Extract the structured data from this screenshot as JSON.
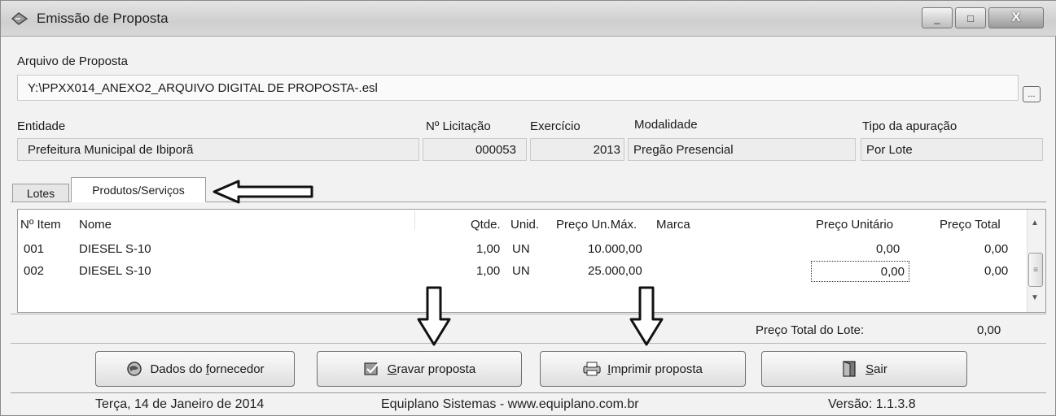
{
  "window": {
    "title": "Emissão de Proposta",
    "close_glyph": "X",
    "min_glyph": "_",
    "max_glyph": "□"
  },
  "arquivo": {
    "label": "Arquivo de Proposta",
    "value": "Y:\\PPXX014_ANEXO2_ARQUIVO DIGITAL DE PROPOSTA-.esl",
    "browse_label": "..."
  },
  "info": {
    "entidade_label": "Entidade",
    "entidade_value": "Prefeitura Municipal de Ibiporã",
    "licitacao_label": "Nº Licitação",
    "licitacao_value": "000053",
    "exercicio_label": "Exercício",
    "exercicio_value": "2013",
    "modalidade_label": "Modalidade",
    "modalidade_value": "Pregão Presencial",
    "apuracao_label": "Tipo da apuração",
    "apuracao_value": "Por Lote"
  },
  "tabs": [
    {
      "label": "Lotes",
      "active": false
    },
    {
      "label": "Produtos/Serviços",
      "active": true
    }
  ],
  "grid": {
    "columns": [
      "Nº Item",
      "Nome",
      "Qtde.",
      "Unid.",
      "Preço Un.Máx.",
      "Marca",
      "Preço Unitário",
      "Preço Total"
    ],
    "rows": [
      {
        "item": "001",
        "nome": "DIESEL S-10",
        "qtde": "1,00",
        "unid": "UN",
        "preco_max": "10.000,00",
        "marca": "",
        "preco_unit": "0,00",
        "preco_total": "0,00"
      },
      {
        "item": "002",
        "nome": "DIESEL S-10",
        "qtde": "1,00",
        "unid": "UN",
        "preco_max": "25.000,00",
        "marca": "",
        "preco_unit": "0,00",
        "preco_total": "0,00"
      }
    ],
    "scroll_up": "▲",
    "scroll_down": "▼",
    "scroll_grip": "≡"
  },
  "total": {
    "label": "Preço Total do Lote:",
    "value": "0,00"
  },
  "buttons": {
    "dados_pre": "Dados do ",
    "dados_key": "f",
    "dados_post": "ornecedor",
    "gravar_key": "G",
    "gravar_post": "ravar proposta",
    "imprimir_key": "I",
    "imprimir_post": "mprimir proposta",
    "sair_key": "S",
    "sair_post": "air"
  },
  "status": {
    "date": "Terça, 14 de Janeiro de 2014",
    "company": "Equiplano Sistemas - www.equiplano.com.br",
    "version": "Versão: 1.1.3.8"
  },
  "icons": {
    "title": "app-icon",
    "dados": "globe-icon",
    "gravar": "checkbox-icon",
    "imprimir": "printer-icon",
    "sair": "exit-door-icon",
    "annotations": [
      "arrow-left-annotation",
      "arrow-down-annotation"
    ]
  }
}
